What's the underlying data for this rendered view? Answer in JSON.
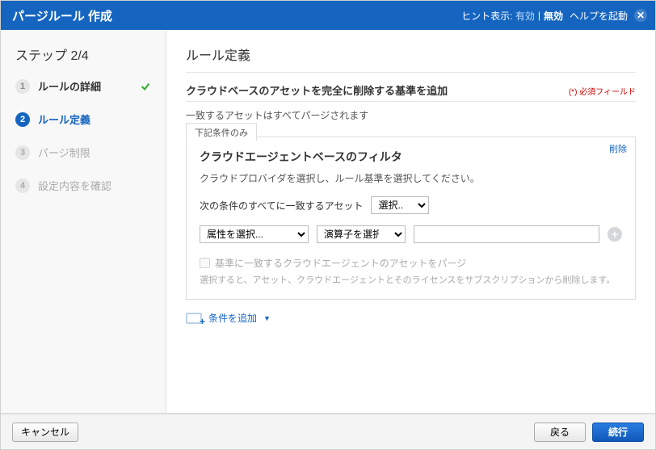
{
  "header": {
    "title": "パージルール 作成",
    "hint_label": "ヒント表示:",
    "hint_on": "有効",
    "hint_off": "無効",
    "help": "ヘルプを起動",
    "close_glyph": "✕"
  },
  "sidebar": {
    "step_title": "ステップ 2/4",
    "steps": [
      {
        "num": "1",
        "label": "ルールの詳細",
        "state": "complete",
        "checked": true
      },
      {
        "num": "2",
        "label": "ルール定義",
        "state": "active",
        "checked": false
      },
      {
        "num": "3",
        "label": "パージ制限",
        "state": "pending",
        "checked": false
      },
      {
        "num": "4",
        "label": "設定内容を確認",
        "state": "pending",
        "checked": false
      }
    ]
  },
  "main": {
    "page_title": "ルール定義",
    "subtitle": "クラウドベースのアセットを完全に削除する基準を追加",
    "required_label": "必須フィールド",
    "match_desc": "一致するアセットはすべてパージされます",
    "tab_label": "下記条件のみ",
    "delete_label": "削除",
    "criteria_title": "クラウドエージェントベースのフィルタ",
    "criteria_desc": "クラウドプロバイダを選択し、ルール基準を選択してください。",
    "match_all_label": "次の条件のすべてに一致するアセット",
    "provider_selected": "選択...",
    "attribute_selected": "属性を選択...",
    "operator_selected": "演算子を選択...",
    "value_text": "",
    "purge_agent_label": "基準に一致するクラウドエージェントのアセットをパージ",
    "purge_agent_hint": "選択すると、アセット、クラウドエージェントとそのライセンスをサブスクリプションから削除します。",
    "add_condition_label": "条件を追加"
  },
  "footer": {
    "cancel": "キャンセル",
    "back": "戻る",
    "continue": "続行"
  }
}
